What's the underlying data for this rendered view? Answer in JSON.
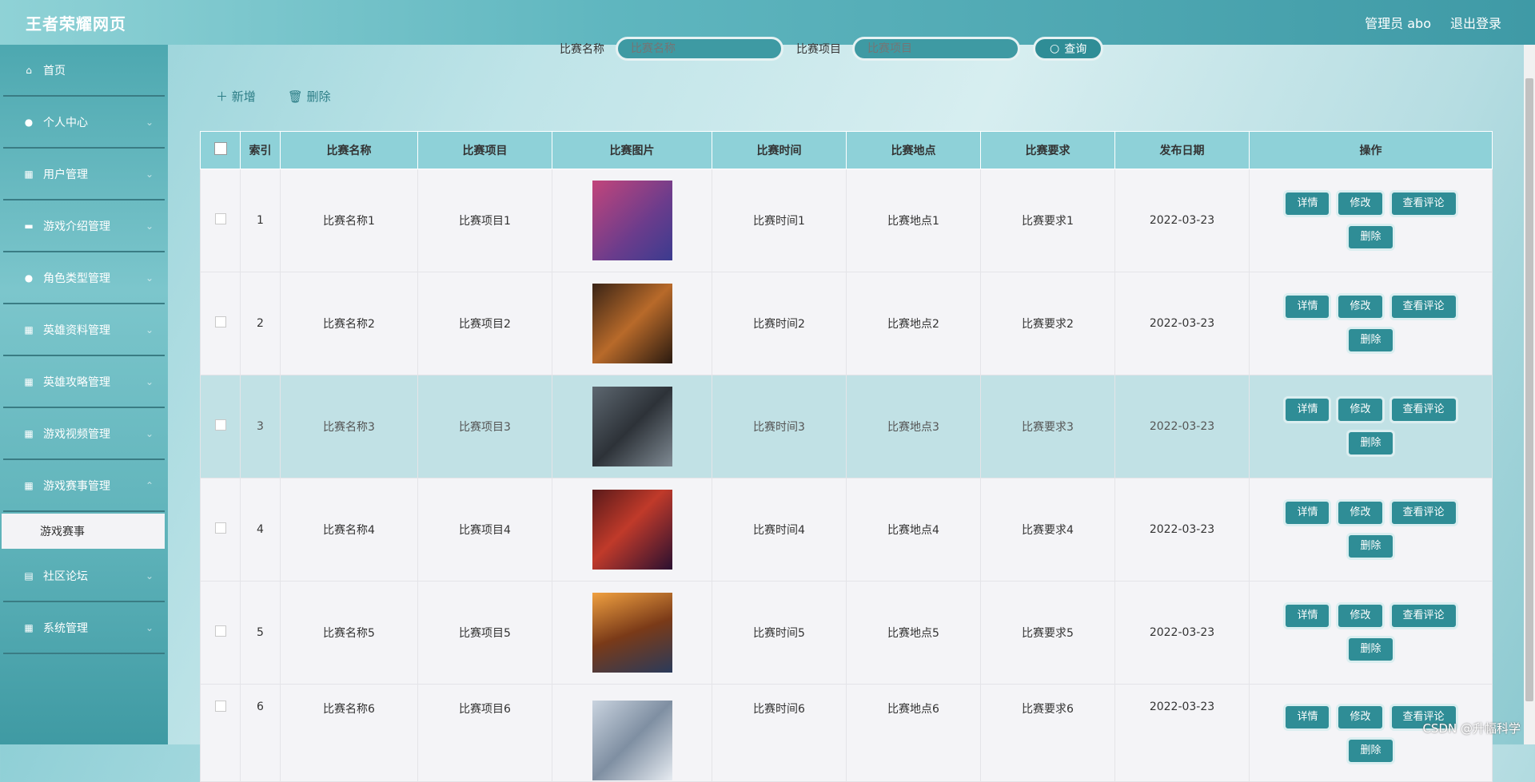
{
  "header": {
    "title": "王者荣耀网页",
    "admin": "管理员 abo",
    "logout": "退出登录"
  },
  "sidebar": {
    "items": [
      {
        "label": "首页",
        "icon": "home-icon"
      },
      {
        "label": "个人中心",
        "icon": "user-icon"
      },
      {
        "label": "用户管理",
        "icon": "grid-icon"
      },
      {
        "label": "游戏介绍管理",
        "icon": "chat-icon"
      },
      {
        "label": "角色类型管理",
        "icon": "user-icon"
      },
      {
        "label": "英雄资料管理",
        "icon": "grid-icon"
      },
      {
        "label": "英雄攻略管理",
        "icon": "grid-icon"
      },
      {
        "label": "游戏视频管理",
        "icon": "grid-icon"
      },
      {
        "label": "游戏赛事管理",
        "icon": "grid-icon"
      },
      {
        "label": "社区论坛",
        "icon": "print-icon"
      },
      {
        "label": "系统管理",
        "icon": "grid-icon"
      }
    ],
    "submenu_active": "游戏赛事"
  },
  "search": {
    "name_label": "比赛名称",
    "name_placeholder": "比赛名称",
    "project_label": "比赛项目",
    "project_placeholder": "比赛项目",
    "button": "查询"
  },
  "actions": {
    "add": "新增",
    "delete": "删除"
  },
  "table": {
    "headers": [
      "索引",
      "比赛名称",
      "比赛项目",
      "比赛图片",
      "比赛时间",
      "比赛地点",
      "比赛要求",
      "发布日期",
      "操作"
    ],
    "rows": [
      {
        "idx": "1",
        "name": "比赛名称1",
        "project": "比赛项目1",
        "time": "比赛时间1",
        "place": "比赛地点1",
        "req": "比赛要求1",
        "date": "2022-03-23"
      },
      {
        "idx": "2",
        "name": "比赛名称2",
        "project": "比赛项目2",
        "time": "比赛时间2",
        "place": "比赛地点2",
        "req": "比赛要求2",
        "date": "2022-03-23"
      },
      {
        "idx": "3",
        "name": "比赛名称3",
        "project": "比赛项目3",
        "time": "比赛时间3",
        "place": "比赛地点3",
        "req": "比赛要求3",
        "date": "2022-03-23"
      },
      {
        "idx": "4",
        "name": "比赛名称4",
        "project": "比赛项目4",
        "time": "比赛时间4",
        "place": "比赛地点4",
        "req": "比赛要求4",
        "date": "2022-03-23"
      },
      {
        "idx": "5",
        "name": "比赛名称5",
        "project": "比赛项目5",
        "time": "比赛时间5",
        "place": "比赛地点5",
        "req": "比赛要求5",
        "date": "2022-03-23"
      },
      {
        "idx": "6",
        "name": "比赛名称6",
        "project": "比赛项目6",
        "time": "比赛时间6",
        "place": "比赛地点6",
        "req": "比赛要求6",
        "date": "2022-03-23"
      }
    ],
    "ops": {
      "detail": "详情",
      "edit": "修改",
      "comments": "查看评论",
      "delete": "删除"
    },
    "highlight_row": 3
  },
  "watermark": "CSDN @升幅科学",
  "colors": {
    "accent": "#2f8d96",
    "header_bg": "#8ed1d8",
    "highlight_row_bg": "#c1e1e5"
  }
}
